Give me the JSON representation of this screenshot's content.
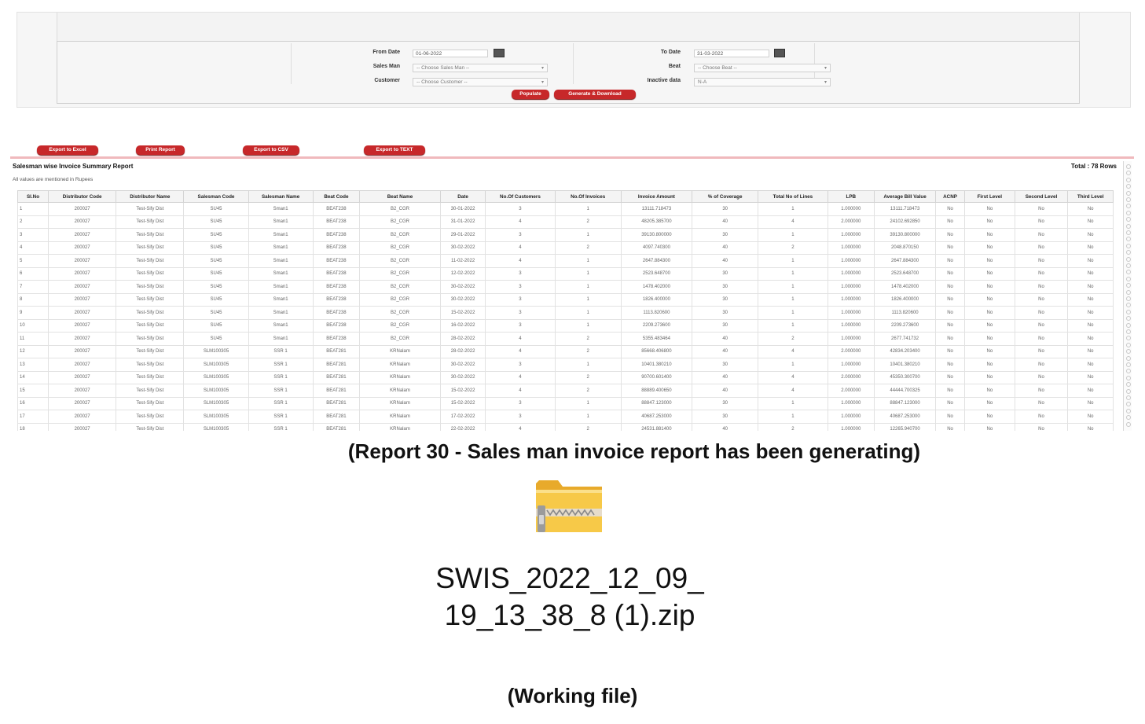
{
  "filters": {
    "from_date_label": "From Date",
    "from_date_value": "01-06-2022",
    "to_date_label": "To Date",
    "to_date_value": "31-03-2022",
    "salesman_label": "Sales Man",
    "salesman_value": "-- Choose Sales Man --",
    "beat_label": "Beat",
    "beat_value": "-- Choose Beat --",
    "customer_label": "Customer",
    "customer_value": "-- Choose Customer --",
    "inactive_label": "Inactive data",
    "inactive_value": "N-A",
    "populate_label": "Populate",
    "generate_label": "Generate & Download"
  },
  "exports": {
    "excel": "Export to Excel",
    "print": "Print Report",
    "csv": "Export to CSV",
    "text": "Export to TEXT"
  },
  "report": {
    "title": "Salesman wise Invoice Summary Report",
    "total": "Total : 78 Rows",
    "note": "All values are mentioned in Rupees",
    "columns": [
      "Sl.No",
      "Distributor Code",
      "Distributor Name",
      "Salesman Code",
      "Salesman Name",
      "Beat Code",
      "Beat Name",
      "Date",
      "No.Of Customers",
      "No.Of Invoices",
      "Invoice Amount",
      "% of Coverage",
      "Total No of Lines",
      "LPB",
      "Average Bill Value",
      "ACNP",
      "First Level",
      "Second Level",
      "Third Level"
    ],
    "rows": [
      [
        "1",
        "200027",
        "Test-Sify Dist",
        "SU45",
        "Sman1",
        "BEAT238",
        "B2_CGR",
        "30-01-2022",
        "3",
        "1",
        "13111.718473",
        "30",
        "1",
        "1.000000",
        "13111.718473",
        "No",
        "No",
        "No",
        "No"
      ],
      [
        "2",
        "200027",
        "Test-Sify Dist",
        "SU45",
        "Sman1",
        "BEAT238",
        "B2_CGR",
        "31-01-2022",
        "4",
        "2",
        "48205.385700",
        "40",
        "4",
        "2.000000",
        "24102.692850",
        "No",
        "No",
        "No",
        "No"
      ],
      [
        "3",
        "200027",
        "Test-Sify Dist",
        "SU45",
        "Sman1",
        "BEAT238",
        "B2_CGR",
        "29-01-2022",
        "3",
        "1",
        "39130.800000",
        "30",
        "1",
        "1.000000",
        "39130.800000",
        "No",
        "No",
        "No",
        "No"
      ],
      [
        "4",
        "200027",
        "Test-Sify Dist",
        "SU45",
        "Sman1",
        "BEAT238",
        "B2_CGR",
        "30-02-2022",
        "4",
        "2",
        "4097.740300",
        "40",
        "2",
        "1.000000",
        "2048.870150",
        "No",
        "No",
        "No",
        "No"
      ],
      [
        "5",
        "200027",
        "Test-Sify Dist",
        "SU45",
        "Sman1",
        "BEAT238",
        "B2_CGR",
        "11-02-2022",
        "4",
        "1",
        "2647.884300",
        "40",
        "1",
        "1.000000",
        "2647.884300",
        "No",
        "No",
        "No",
        "No"
      ],
      [
        "6",
        "200027",
        "Test-Sify Dist",
        "SU45",
        "Sman1",
        "BEAT238",
        "B2_CGR",
        "12-02-2022",
        "3",
        "1",
        "2523.648700",
        "30",
        "1",
        "1.000000",
        "2523.648700",
        "No",
        "No",
        "No",
        "No"
      ],
      [
        "7",
        "200027",
        "Test-Sify Dist",
        "SU45",
        "Sman1",
        "BEAT238",
        "B2_CGR",
        "30-02-2022",
        "3",
        "1",
        "1478.402000",
        "30",
        "1",
        "1.000000",
        "1478.402000",
        "No",
        "No",
        "No",
        "No"
      ],
      [
        "8",
        "200027",
        "Test-Sify Dist",
        "SU45",
        "Sman1",
        "BEAT238",
        "B2_CGR",
        "30-02-2022",
        "3",
        "1",
        "1826.400000",
        "30",
        "1",
        "1.000000",
        "1826.400000",
        "No",
        "No",
        "No",
        "No"
      ],
      [
        "9",
        "200027",
        "Test-Sify Dist",
        "SU45",
        "Sman1",
        "BEAT238",
        "B2_CGR",
        "15-02-2022",
        "3",
        "1",
        "1113.820600",
        "30",
        "1",
        "1.000000",
        "1113.820600",
        "No",
        "No",
        "No",
        "No"
      ],
      [
        "10",
        "200027",
        "Test-Sify Dist",
        "SU45",
        "Sman1",
        "BEAT238",
        "B2_CGR",
        "16-02-2022",
        "3",
        "1",
        "2209.273600",
        "30",
        "1",
        "1.000000",
        "2209.273600",
        "No",
        "No",
        "No",
        "No"
      ],
      [
        "11",
        "200027",
        "Test-Sify Dist",
        "SU45",
        "Sman1",
        "BEAT238",
        "B2_CGR",
        "28-02-2022",
        "4",
        "2",
        "5355.483464",
        "40",
        "2",
        "1.000000",
        "2677.741732",
        "No",
        "No",
        "No",
        "No"
      ],
      [
        "12",
        "200027",
        "Test-Sify Dist",
        "SLM100305",
        "SSR 1",
        "BEAT281",
        "KRNalam",
        "28-02-2022",
        "4",
        "2",
        "85668.406800",
        "40",
        "4",
        "2.000000",
        "42834.203400",
        "No",
        "No",
        "No",
        "No"
      ],
      [
        "13",
        "200027",
        "Test-Sify Dist",
        "SLM100305",
        "SSR 1",
        "BEAT281",
        "KRNalam",
        "30-02-2022",
        "3",
        "1",
        "10401.380210",
        "30",
        "1",
        "1.000000",
        "10401.380210",
        "No",
        "No",
        "No",
        "No"
      ],
      [
        "14",
        "200027",
        "Test-Sify Dist",
        "SLM100305",
        "SSR 1",
        "BEAT281",
        "KRNalam",
        "30-02-2022",
        "4",
        "2",
        "90700.601400",
        "40",
        "4",
        "2.000000",
        "45350.300700",
        "No",
        "No",
        "No",
        "No"
      ],
      [
        "15",
        "200027",
        "Test-Sify Dist",
        "SLM100305",
        "SSR 1",
        "BEAT281",
        "KRNalam",
        "15-02-2022",
        "4",
        "2",
        "88889.400650",
        "40",
        "4",
        "2.000000",
        "44444.700325",
        "No",
        "No",
        "No",
        "No"
      ],
      [
        "16",
        "200027",
        "Test-Sify Dist",
        "SLM100305",
        "SSR 1",
        "BEAT281",
        "KRNalam",
        "15-02-2022",
        "3",
        "1",
        "88847.123000",
        "30",
        "1",
        "1.000000",
        "88847.123000",
        "No",
        "No",
        "No",
        "No"
      ],
      [
        "17",
        "200027",
        "Test-Sify Dist",
        "SLM100305",
        "SSR 1",
        "BEAT281",
        "KRNalam",
        "17-02-2022",
        "3",
        "1",
        "40687.253000",
        "30",
        "1",
        "1.000000",
        "40687.253000",
        "No",
        "No",
        "No",
        "No"
      ],
      [
        "18",
        "200027",
        "Test-Sify Dist",
        "SLM100305",
        "SSR 1",
        "BEAT281",
        "KRNalam",
        "22-02-2022",
        "4",
        "2",
        "24531.881400",
        "40",
        "2",
        "1.000000",
        "12265.940700",
        "No",
        "No",
        "No",
        "No"
      ]
    ]
  },
  "caption_report": "(Report 30 - Sales man invoice report has been generating)",
  "zip_icon": "zip-folder-icon",
  "file_name_line1": "SWIS_2022_12_09_",
  "file_name_line2": "19_13_38_8 (1).zip",
  "caption_file": "(Working file)",
  "colors": {
    "button_red": "#c7282a",
    "accent_pink": "#f0b9bd",
    "folder_yellow": "#f7c948"
  }
}
